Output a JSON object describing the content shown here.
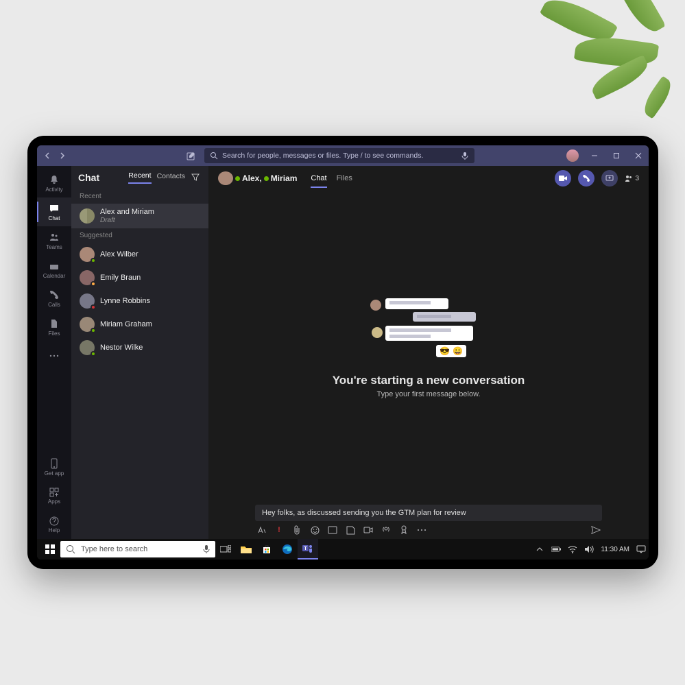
{
  "titlebar": {
    "search_placeholder": "Search for people, messages or files. Type / to see commands."
  },
  "rail": {
    "activity": "Activity",
    "chat": "Chat",
    "teams": "Teams",
    "calendar": "Calendar",
    "calls": "Calls",
    "files": "Files",
    "getapp": "Get app",
    "apps": "Apps",
    "help": "Help"
  },
  "chatlist": {
    "title": "Chat",
    "tab_recent": "Recent",
    "tab_contacts": "Contacts",
    "section_recent": "Recent",
    "section_suggested": "Suggested",
    "recent": [
      {
        "name": "Alex and Miriam",
        "sub": "Draft"
      }
    ],
    "suggested": [
      {
        "name": "Alex Wilber",
        "presence": "available"
      },
      {
        "name": "Emily Braun",
        "presence": "away"
      },
      {
        "name": "Lynne Robbins",
        "presence": "busy"
      },
      {
        "name": "Miriam Graham",
        "presence": "available"
      },
      {
        "name": "Nestor Wilke",
        "presence": "available"
      }
    ]
  },
  "conversation": {
    "participant1": "Alex,",
    "participant2": "Miriam",
    "tab_chat": "Chat",
    "tab_files": "Files",
    "people_count": "3",
    "empty_title": "You're starting a new conversation",
    "empty_sub": "Type your first message below."
  },
  "composer": {
    "draft": "Hey folks, as discussed sending you the GTM plan for review"
  },
  "taskbar": {
    "search_placeholder": "Type here to search",
    "time": "11:30 AM"
  }
}
